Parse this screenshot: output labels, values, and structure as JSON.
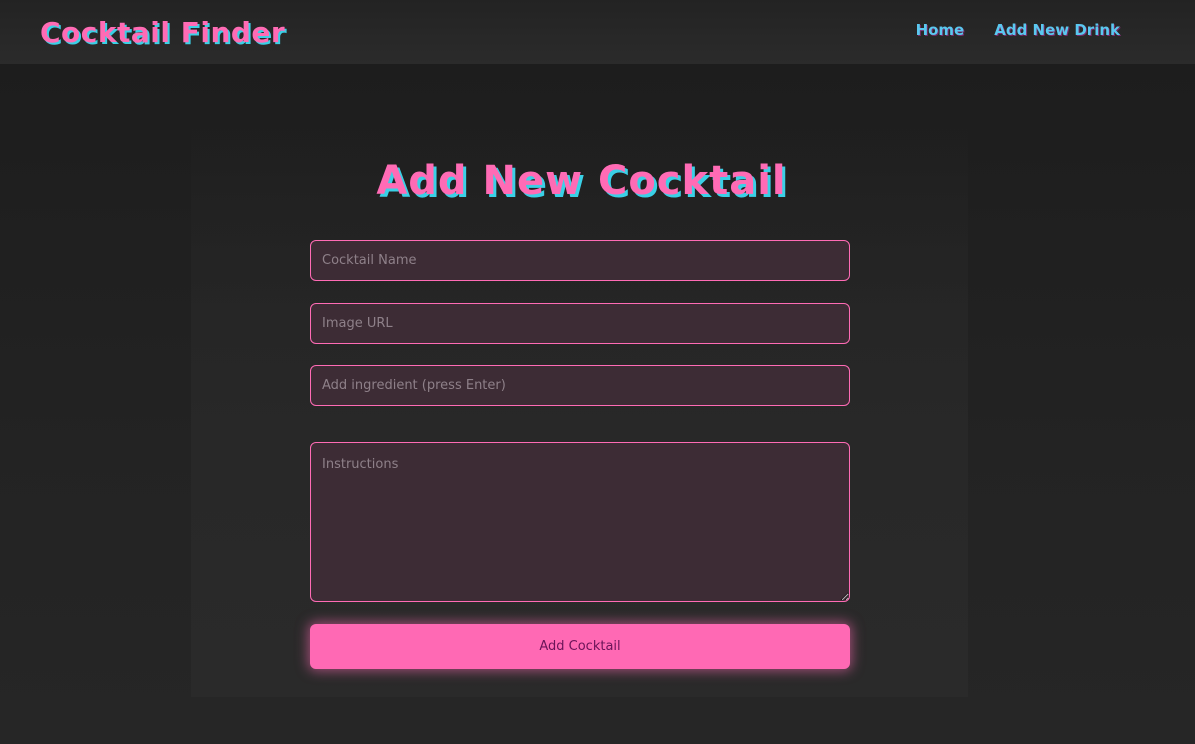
{
  "navbar": {
    "brand": "Cocktail Finder",
    "links": [
      {
        "label": "Home"
      },
      {
        "label": "Add New Drink"
      }
    ]
  },
  "form": {
    "title": "Add New Cocktail",
    "name_placeholder": "Cocktail Name",
    "image_placeholder": "Image URL",
    "ingredient_placeholder": "Add ingredient (press Enter)",
    "instructions_placeholder": "Instructions",
    "submit_label": "Add Cocktail"
  },
  "colors": {
    "accent_pink": "#ff69b4",
    "accent_cyan": "#3ad0e6",
    "link_blue": "#5ac8f0",
    "background": "#1c1c1c",
    "field_bg": "#3d2c35"
  }
}
